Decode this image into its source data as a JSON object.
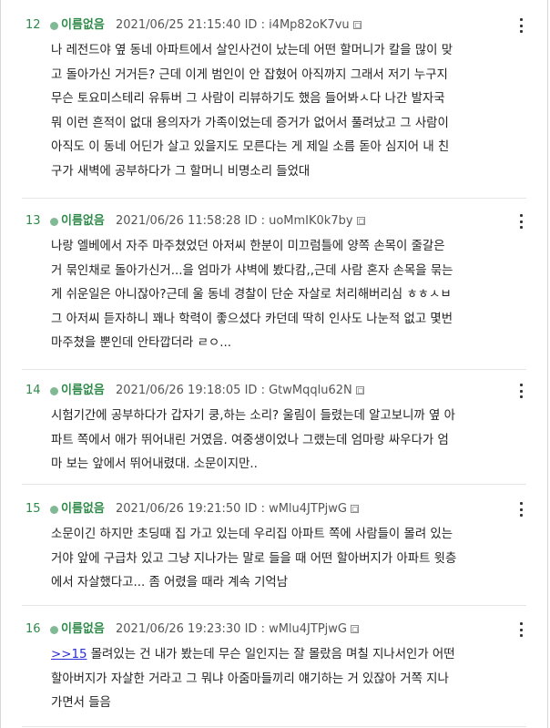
{
  "posts": [
    {
      "number": "12",
      "name": "이름없음",
      "date": "2021/06/25 21:15:40",
      "id": "ID : i4Mp82oK7vu",
      "lines": [
        "나 레전드야 옆 동네 아파트에서 살인사건이 났는데 어떤 할머니가 칼을 많이 맞",
        "고 돌아가신 거거든? 근데 이게 범인이 안 잡혔어 아직까지 그래서 저기 누구지",
        "무슨 토요미스테리 유튜버 그 사람이 리뷰하기도 했음 들어봐ㅅ다 나간 발자국",
        "뭐 이런 흔적이 없대 용의자가 가족이었는데 증거가 없어서 풀려났고 그 사람이",
        "아직도 이 동네 어딘가 살고 있을지도 모른다는 게 제일 소름 돋아 심지어 내 친",
        "구가 새벽에 공부하다가 그 할머니 비명소리 들었대"
      ]
    },
    {
      "number": "13",
      "name": "이름없음",
      "date": "2021/06/26 11:58:28",
      "id": "ID : uoMmIK0k7by",
      "lines": [
        "나랑 엘베에서 자주 마주쳤었던 아저씨 한분이 미끄럼틀에 양쪽 손목이 줄갈은",
        "거 묶인채로 돌아가신거...을 엄마가 샤벽에 봤다캄,,근데 사람 혼자 손목을 묶는",
        "게 쉬운일은 아니잖아?근데 울 동네 경찰이 단순 자살로 처리해버리심 ㅎㅎㅅㅂ",
        "그 아저씨 듣자하니 꽤나 학력이 좋으셨다 카던데 딱히 인사도 나눈적 없고 몇번",
        "마주쳤을 뿐인데 안타깝더라 ㄹㅇ..."
      ]
    },
    {
      "number": "14",
      "name": "이름없음",
      "date": "2021/06/26 19:18:05",
      "id": "ID : GtwMqqlu62N",
      "lines": [
        "시험기간에 공부하다가 갑자기 쿵,하는 소리? 울림이 들렸는데 알고보니까 옆 아",
        "파트 쪽에서 애가 뛰어내린 거였음. 여중생이었나 그랬는데 엄마랑 싸우다가 엄",
        "마 보는 앞에서 뛰어내렸대. 소문이지만.."
      ]
    },
    {
      "number": "15",
      "name": "이름없음",
      "date": "2021/06/26 19:21:50",
      "id": "ID : wMlu4JTPjwG",
      "lines": [
        "소문이긴 하지만 초딩때 집 가고 있는데 우리집 아파트 쪽에 사람들이 몰려 있는",
        "거야 앞에 구급차 있고 그냥 지나가는 말로 들을 때 어떤 할아버지가 아파트 윗층",
        "에서 자살했다고... 좀 어렸을 때라 계속 기억남"
      ]
    },
    {
      "number": "16",
      "name": "이름없음",
      "date": "2021/06/26 19:23:30",
      "id": "ID : wMlu4JTPjwG",
      "anchor": ">>15",
      "lines": [
        " 몰려있는 건 내가 봤는데 무슨 일인지는 잘 몰랐음 며칠 지나서인가 어떤",
        "할아버지가 자살한 거라고 그 뭐냐 아줌마들끼리 얘기하는 거 있잖아 거쪽 지나",
        "가면서 들음"
      ]
    }
  ]
}
